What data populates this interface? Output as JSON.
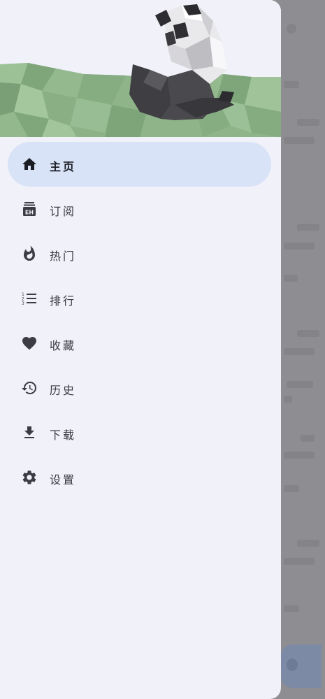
{
  "drawer": {
    "items": [
      {
        "label": "主页",
        "icon": "home-icon",
        "active": true
      },
      {
        "label": "订阅",
        "icon": "eh-subscription-icon",
        "active": false
      },
      {
        "label": "热门",
        "icon": "fire-icon",
        "active": false
      },
      {
        "label": "排行",
        "icon": "ranked-list-icon",
        "active": false
      },
      {
        "label": "收藏",
        "icon": "heart-icon",
        "active": false
      },
      {
        "label": "历史",
        "icon": "history-icon",
        "active": false
      },
      {
        "label": "下载",
        "icon": "download-icon",
        "active": false
      },
      {
        "label": "设置",
        "icon": "gear-icon",
        "active": false
      }
    ]
  },
  "colors": {
    "drawer_bg": "#f0f1f9",
    "active_item_bg": "#d8e3f7",
    "icon": "#3c3c42",
    "active_icon": "#1b1d24",
    "scrim": "#8e8e92"
  }
}
